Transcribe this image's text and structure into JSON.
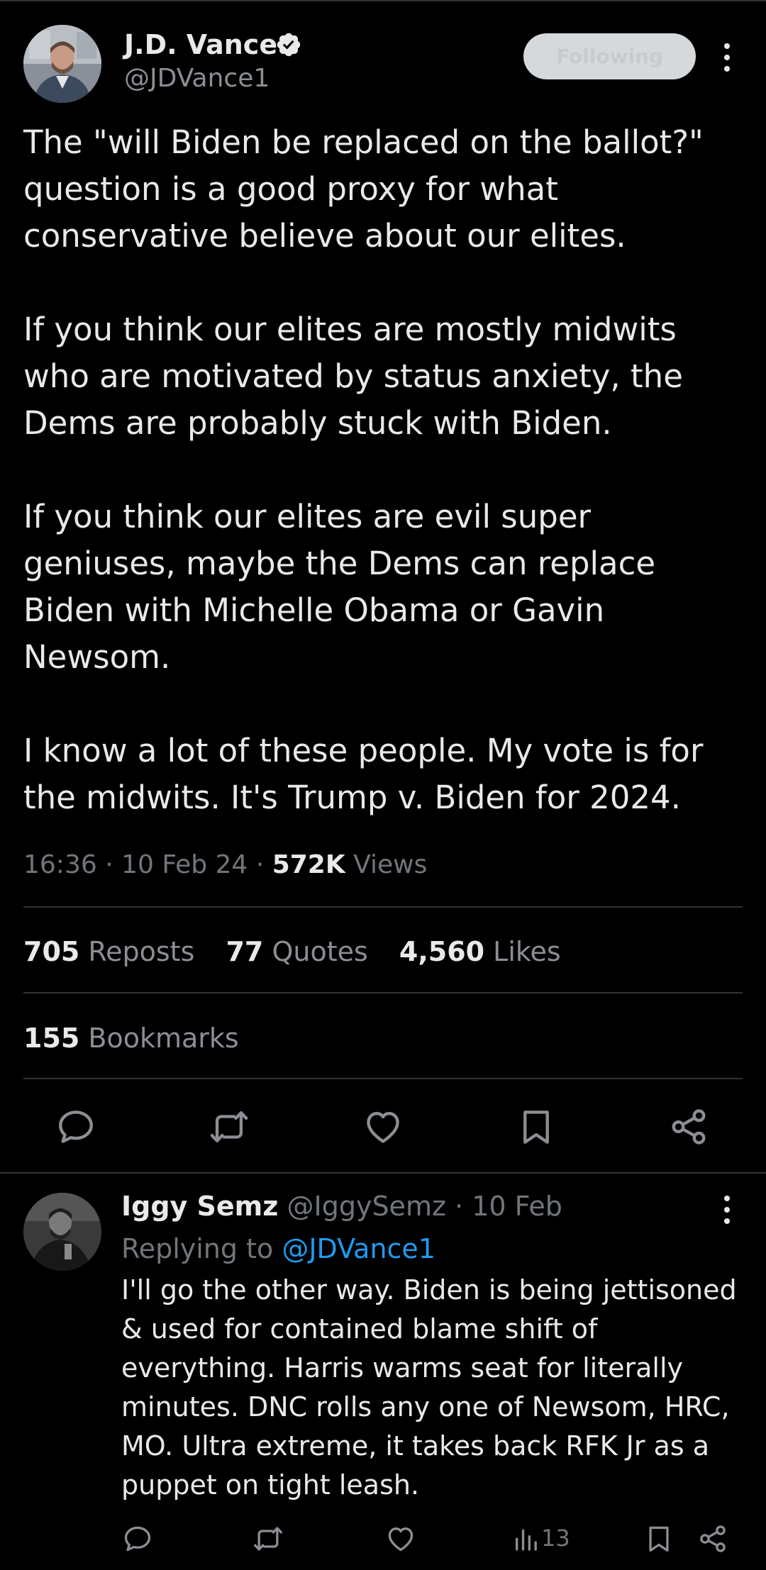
{
  "tweet": {
    "author": {
      "name": "J.D. Vance",
      "handle": "@JDVance1",
      "verified": true
    },
    "follow_label": "Following",
    "paragraphs": [
      "The \"will Biden be replaced on the ballot?\" question is a good proxy for what conservative believe about our elites.",
      "If you think our elites are mostly midwits who are motivated by status anxiety, the Dems are probably stuck with Biden.",
      "If you think our elites are evil super geniuses, maybe the Dems can replace Biden with Michelle Obama or Gavin Newsom.",
      "I know a lot of these people. My vote is for the midwits. It's Trump v. Biden for 2024."
    ],
    "time": "16:36",
    "date": "10 Feb 24",
    "views_count": "572K",
    "views_label": "Views",
    "reposts_count": "705",
    "reposts_label": "Reposts",
    "quotes_count": "77",
    "quotes_label": "Quotes",
    "likes_count": "4,560",
    "likes_label": "Likes",
    "bookmarks_count": "155",
    "bookmarks_label": "Bookmarks"
  },
  "reply": {
    "name": "Iggy Semz",
    "handle": "@IggySemz",
    "date": "10 Feb",
    "replying_prefix": "Replying to",
    "replying_mention": "@JDVance1",
    "text": "I'll go the other way. Biden is being jettisoned & used for contained blame shift of everything. Harris warms seat for literally minutes. DNC rolls any one of Newsom, HRC, MO. Ultra extreme, it takes back RFK Jr as a puppet on tight leash.",
    "views_count": "13"
  },
  "colors": {
    "background": "#000000",
    "text": "#e7e9ea",
    "muted": "#71767b",
    "accent": "#1d9bf0",
    "divider": "#2f3336"
  },
  "icons": [
    "more-icon",
    "verified-badge-icon",
    "reply-icon",
    "repost-icon",
    "like-icon",
    "bookmark-icon",
    "share-icon",
    "views-icon"
  ]
}
